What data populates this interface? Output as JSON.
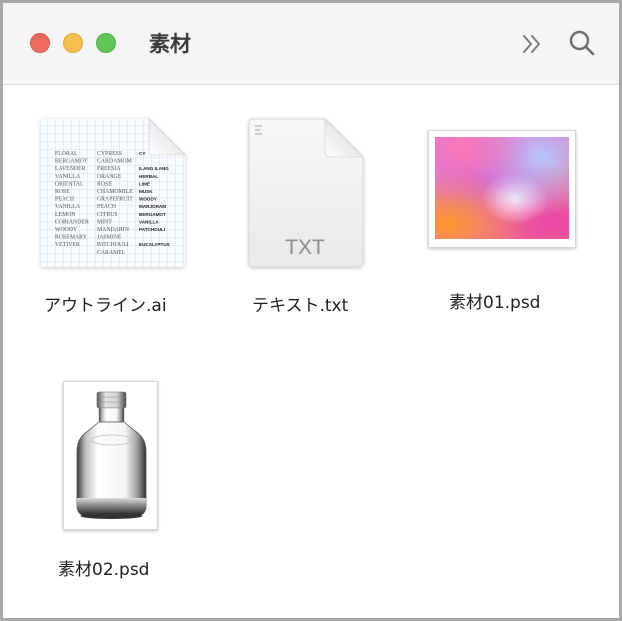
{
  "window": {
    "title": "素材"
  },
  "toolbar": {
    "more_icon": "chevron-double-right-icon",
    "search_icon": "search-icon"
  },
  "files": [
    {
      "name": "アウトライン.ai",
      "kind": "illustrator-document",
      "preview_words": {
        "col1": [
          "FLORAL",
          "BERGAMOT",
          "LAVENDER",
          "VANILLA",
          "ORIENTAL",
          "ROSE",
          "PEACH",
          "VANILLA",
          "LEMON",
          "CORIANDER",
          "WOODY",
          "ROSEMARY",
          "VETIVER"
        ],
        "col2": [
          "CYPRESS",
          "CARDAMOM",
          "FREESIA",
          "ORANGE",
          "ROSE",
          "CHAMOMILE",
          "GRAPEFRUIT",
          "PEACH",
          "CITRUS",
          "MINT",
          "MANDARIN",
          "JASMINE",
          "PATCHOULI",
          "CARAMEL"
        ],
        "col3": [
          "CY",
          "",
          "ILANG ILANG",
          "HERBAL",
          "LIME",
          "MUSK",
          "WOODY",
          "MARJORAM",
          "BERGAMOT",
          "VANILLA",
          "PATCHOULI",
          "",
          "EUCALYPTUS"
        ]
      }
    },
    {
      "name": "テキスト.txt",
      "kind": "text-document",
      "icon_text": "TXT"
    },
    {
      "name": "素材01.psd",
      "kind": "photoshop-image"
    },
    {
      "name": "素材02.psd",
      "kind": "photoshop-image"
    }
  ],
  "colors": {
    "close": "#ee6a5f",
    "minimize": "#f5bf4f",
    "maximize": "#61c554",
    "titlebar": "#f5f5f5",
    "window_border": "#a9a9a9"
  }
}
